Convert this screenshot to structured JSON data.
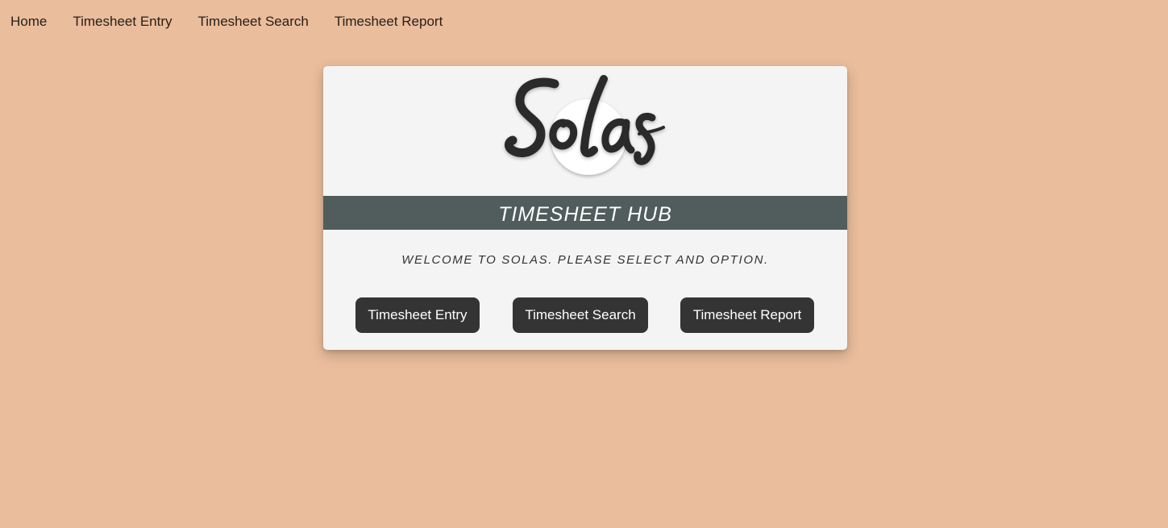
{
  "colors": {
    "page_background": "#EABD9C",
    "card_background": "#F4F4F4",
    "banner_background": "#505D5C",
    "button_background": "#343434",
    "button_text": "#FFFFFF",
    "logo_ink": "#2B2B2B"
  },
  "nav": {
    "items": [
      {
        "label": "Home"
      },
      {
        "label": "Timesheet Entry"
      },
      {
        "label": "Timesheet Search"
      },
      {
        "label": "Timesheet Report"
      }
    ]
  },
  "card": {
    "logo_text": "Solas",
    "banner_title": "TIMESHEET HUB",
    "welcome_text": "WELCOME TO SOLAS. PLEASE SELECT AND OPTION.",
    "buttons": [
      {
        "label": "Timesheet Entry"
      },
      {
        "label": "Timesheet Search"
      },
      {
        "label": "Timesheet Report"
      }
    ]
  }
}
